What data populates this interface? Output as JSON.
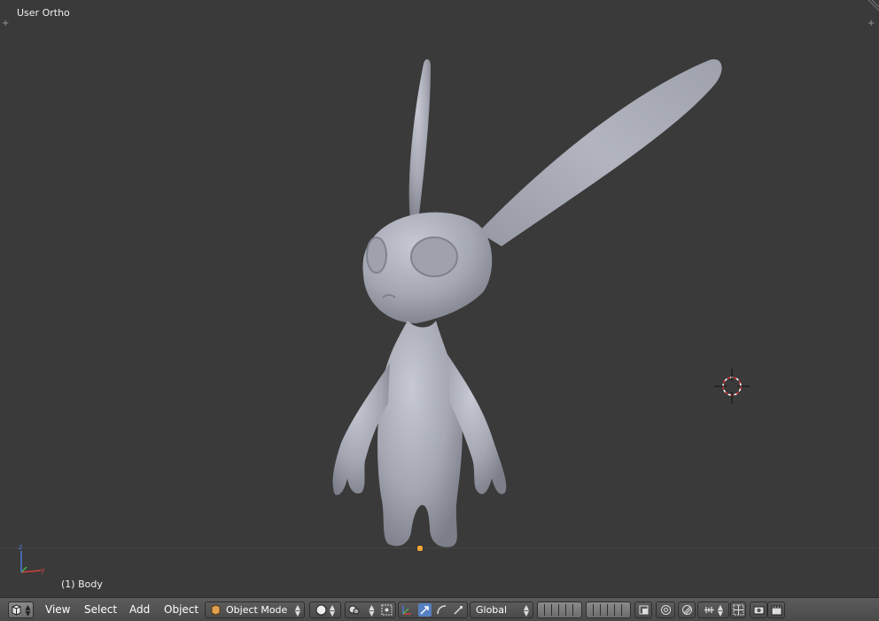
{
  "viewport": {
    "view_label": "User Ortho",
    "object_name": "(1) Body"
  },
  "header": {
    "menus": {
      "view": "View",
      "select": "Select",
      "add": "Add",
      "object": "Object"
    },
    "mode": "Object Mode",
    "orientation": "Global"
  },
  "icons": {
    "editor_type": "cube-view-icon",
    "viewport_shading": "solid-sphere-icon",
    "pivot": "pivot-point-icon",
    "manipulator_toggle": "manipulator-axes-icon",
    "translate": "translate-arrow-icon",
    "rotate": "rotate-arc-icon",
    "scale": "scale-icon",
    "layers": "layer-grid-icon",
    "lock_camera": "lock-layers-icon",
    "proportional": "proportional-edit-icon",
    "snap": "snap-magnet-icon",
    "snap_target": "snap-target-icon",
    "render": "render-camera-icon",
    "render_anim": "clapper-icon"
  },
  "colors": {
    "viewport_bg": "#3a3a3a",
    "mesh": "#a8abb6",
    "header_bg": "#4e4e4e",
    "active_button": "#5680c2",
    "origin": "#f2a33a"
  }
}
